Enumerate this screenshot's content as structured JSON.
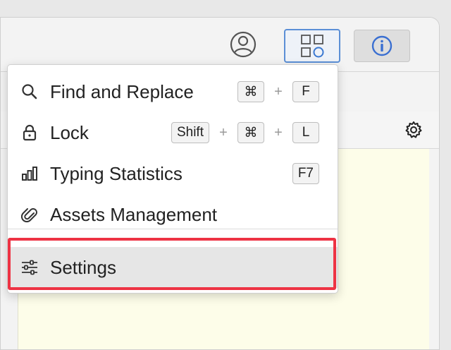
{
  "toolbar": {
    "avatar_icon": "user-circle-icon",
    "panels_icon": "panels-icon",
    "info_icon": "info-icon"
  },
  "menu": {
    "items": [
      {
        "label": "Find and Replace",
        "icon": "search-icon",
        "keys": [
          "⌘",
          "F"
        ]
      },
      {
        "label": "Lock",
        "icon": "lock-icon",
        "keys": [
          "Shift",
          "⌘",
          "L"
        ]
      },
      {
        "label": "Typing Statistics",
        "icon": "bar-chart-icon",
        "keys": [
          "F7"
        ]
      },
      {
        "label": "Assets Management",
        "icon": "paperclip-icon",
        "keys": []
      }
    ],
    "settings": {
      "label": "Settings",
      "icon": "sliders-icon"
    },
    "plus": "+"
  },
  "colors": {
    "accent": "#5b8fd6",
    "highlight": "#ee3344",
    "editor_bg": "#fdfde9"
  }
}
